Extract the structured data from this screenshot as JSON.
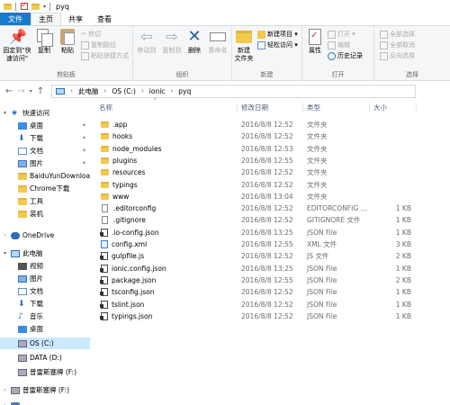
{
  "window": {
    "title": "pyq"
  },
  "ribbon": {
    "tabs": [
      "文件",
      "主页",
      "共享",
      "查看"
    ],
    "clipboard": {
      "pin_label": "固定到\"快速访问\"",
      "copy_label": "复制",
      "paste_label": "粘贴",
      "cut_label": "剪切",
      "copy_path_label": "复制路径",
      "paste_shortcut_label": "粘贴快捷方式",
      "group_label": "剪贴板"
    },
    "organize": {
      "move_label": "移动到",
      "copyto_label": "复制到",
      "delete_label": "删除",
      "rename_label": "重命名",
      "group_label": "组织"
    },
    "new": {
      "newfolder_label": "新建\n文件夹",
      "newitem_label": "新建项目 ▾",
      "easyaccess_label": "轻松访问 ▾",
      "group_label": "新建"
    },
    "open": {
      "properties_label": "属性",
      "open_label": "打开 ▾",
      "edit_label": "编辑",
      "history_label": "历史记录",
      "group_label": "打开"
    },
    "select": {
      "selectall_label": "全部选择",
      "selectnone_label": "全部取消",
      "invert_label": "反向选择",
      "group_label": "选择"
    }
  },
  "address": {
    "crumbs": [
      "此电脑",
      "OS (C:)",
      "ionic",
      "pyq"
    ]
  },
  "nav": {
    "quick_access": "快速访问",
    "quick_items": [
      "桌面",
      "下载",
      "文档",
      "图片",
      "BaiduYunDownload",
      "Chrome下载",
      "工具",
      "装机"
    ],
    "onedrive": "OneDrive",
    "this_pc": "此电脑",
    "pc_items": [
      "视频",
      "图片",
      "文档",
      "下载",
      "音乐",
      "桌面",
      "OS (C:)",
      "DATA (D:)",
      "普雷斯塞牌 (F:)"
    ],
    "external": "普雷斯塞牌 (F:)"
  },
  "columns": {
    "name": "名称",
    "date": "修改日期",
    "type": "类型",
    "size": "大小"
  },
  "files": [
    {
      "icon": "folder",
      "name": ".app",
      "date": "2016/8/8 12:52",
      "type": "文件夹",
      "size": ""
    },
    {
      "icon": "folder",
      "name": "hooks",
      "date": "2016/8/8 12:52",
      "type": "文件夹",
      "size": ""
    },
    {
      "icon": "folder",
      "name": "node_modules",
      "date": "2016/8/8 12:53",
      "type": "文件夹",
      "size": ""
    },
    {
      "icon": "folder",
      "name": "plugins",
      "date": "2016/8/8 12:55",
      "type": "文件夹",
      "size": ""
    },
    {
      "icon": "folder",
      "name": "resources",
      "date": "2016/8/8 12:52",
      "type": "文件夹",
      "size": ""
    },
    {
      "icon": "folder",
      "name": "typings",
      "date": "2016/8/8 12:52",
      "type": "文件夹",
      "size": ""
    },
    {
      "icon": "folder",
      "name": "www",
      "date": "2016/8/8 13:04",
      "type": "文件夹",
      "size": ""
    },
    {
      "icon": "file",
      "name": ".editorconfig",
      "date": "2016/8/8 12:52",
      "type": "EDITORCONFIG ...",
      "size": "1 KB"
    },
    {
      "icon": "file",
      "name": ".gitignore",
      "date": "2016/8/8 12:52",
      "type": "GITIGNORE 文件",
      "size": "1 KB"
    },
    {
      "icon": "json",
      "name": ".io-config.json",
      "date": "2016/8/8 13:25",
      "type": "JSON File",
      "size": "1 KB"
    },
    {
      "icon": "xml",
      "name": "config.xml",
      "date": "2016/8/8 12:55",
      "type": "XML 文件",
      "size": "3 KB"
    },
    {
      "icon": "js",
      "name": "gulpfile.js",
      "date": "2016/8/8 12:52",
      "type": "JS 文件",
      "size": "2 KB"
    },
    {
      "icon": "json",
      "name": "ionic.config.json",
      "date": "2016/8/8 13:25",
      "type": "JSON File",
      "size": "1 KB"
    },
    {
      "icon": "json",
      "name": "package.json",
      "date": "2016/8/8 12:55",
      "type": "JSON File",
      "size": "2 KB"
    },
    {
      "icon": "json",
      "name": "tsconfig.json",
      "date": "2016/8/8 12:52",
      "type": "JSON File",
      "size": "1 KB"
    },
    {
      "icon": "json",
      "name": "tslint.json",
      "date": "2016/8/8 12:52",
      "type": "JSON File",
      "size": "1 KB"
    },
    {
      "icon": "json",
      "name": "typings.json",
      "date": "2016/8/8 12:52",
      "type": "JSON File",
      "size": "1 KB"
    }
  ]
}
